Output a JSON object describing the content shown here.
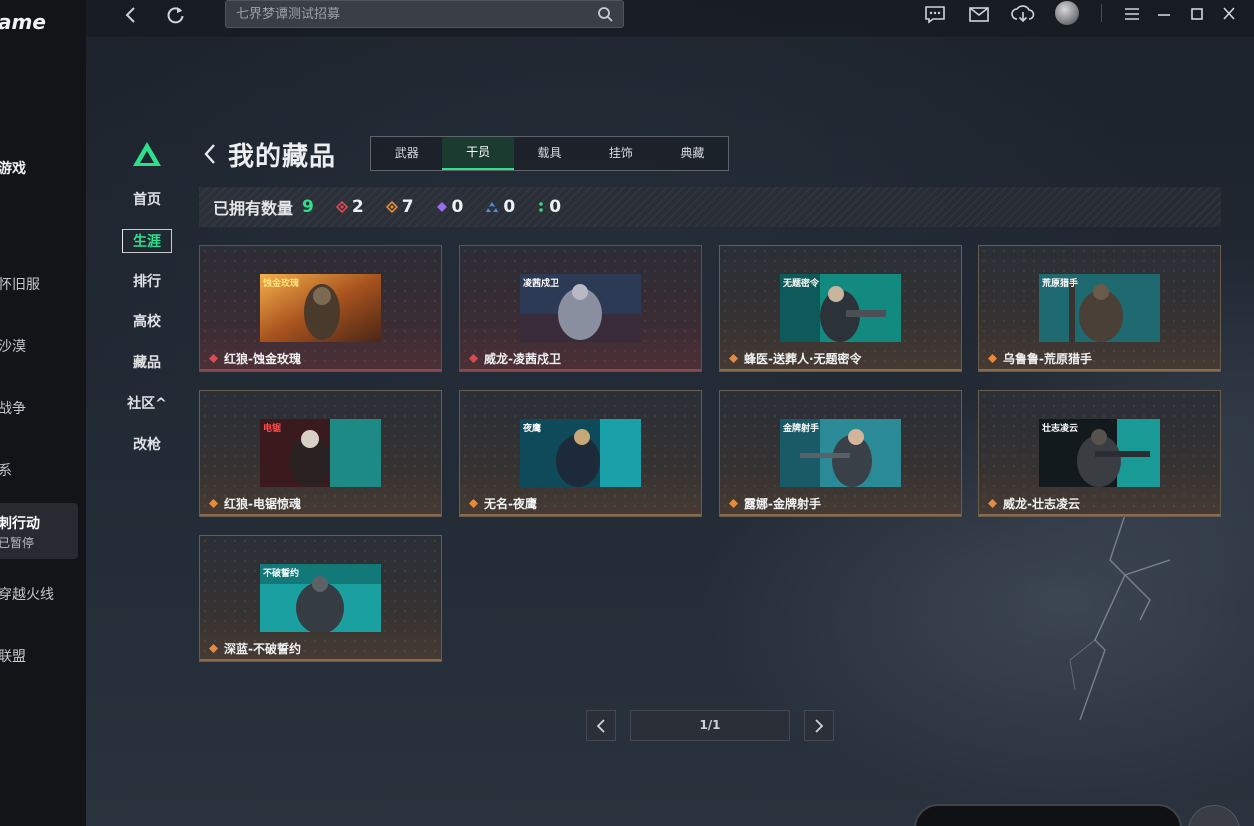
{
  "app": {
    "logo_text": "ame",
    "sidebar_items": [
      {
        "label": "游戏"
      },
      {
        "label": "怀旧服"
      },
      {
        "label": "沙漠"
      },
      {
        "label": "战争"
      },
      {
        "label": "系"
      },
      {
        "label": "穿越火线"
      },
      {
        "label": "联盟"
      }
    ],
    "active_item": {
      "title": "刺行动",
      "subtitle": "已暂停"
    }
  },
  "topbar": {
    "search_placeholder": "七界梦谭测试招募"
  },
  "game_nav": {
    "items": [
      {
        "label": "首页"
      },
      {
        "label": "生涯"
      },
      {
        "label": "排行"
      },
      {
        "label": "高校"
      },
      {
        "label": "藏品"
      },
      {
        "label": "社区^"
      },
      {
        "label": "改枪"
      }
    ],
    "active_index": 1
  },
  "page": {
    "title": "我的藏品",
    "tabs": [
      {
        "label": "武器"
      },
      {
        "label": "干员"
      },
      {
        "label": "载具"
      },
      {
        "label": "挂饰"
      },
      {
        "label": "典藏"
      }
    ],
    "active_tab_index": 1
  },
  "stats": {
    "label": "已拥有数量",
    "total": "9",
    "counts": [
      {
        "gem": "red",
        "color": "#e0484f",
        "value": "2"
      },
      {
        "gem": "orange",
        "color": "#e88a3c",
        "value": "7"
      },
      {
        "gem": "purple",
        "color": "#9b6bf0",
        "value": "0"
      },
      {
        "gem": "blue",
        "color": "#4d8fe8",
        "value": "0"
      },
      {
        "gem": "green",
        "color": "#3cd38a",
        "value": "0"
      }
    ]
  },
  "collection": [
    {
      "name": "红狼-蚀金玫瑰",
      "rarity": "red",
      "banner": "蚀金玫瑰"
    },
    {
      "name": "威龙-凌茜戍卫",
      "rarity": "red",
      "banner": "凌茜戍卫"
    },
    {
      "name": "蜂医-送葬人·无题密令",
      "rarity": "orange",
      "banner": "无题密令"
    },
    {
      "name": "乌鲁鲁-荒原猎手",
      "rarity": "orange",
      "banner": "荒原猎手"
    },
    {
      "name": "红狼-电锯惊魂",
      "rarity": "orange",
      "banner": "电锯"
    },
    {
      "name": "无名-夜鹰",
      "rarity": "orange",
      "banner": "夜鹰"
    },
    {
      "name": "露娜-金牌射手",
      "rarity": "orange",
      "banner": "金牌射手"
    },
    {
      "name": "威龙-壮志凌云",
      "rarity": "orange",
      "banner": "壮志凌云"
    },
    {
      "name": "深蓝-不破誓约",
      "rarity": "orange",
      "banner": "不破誓约"
    }
  ],
  "pagination": {
    "text": "1/1"
  },
  "colors": {
    "accent_green": "#2ee08a",
    "rarity_red": "#e0484f",
    "rarity_orange": "#e88a3c"
  }
}
